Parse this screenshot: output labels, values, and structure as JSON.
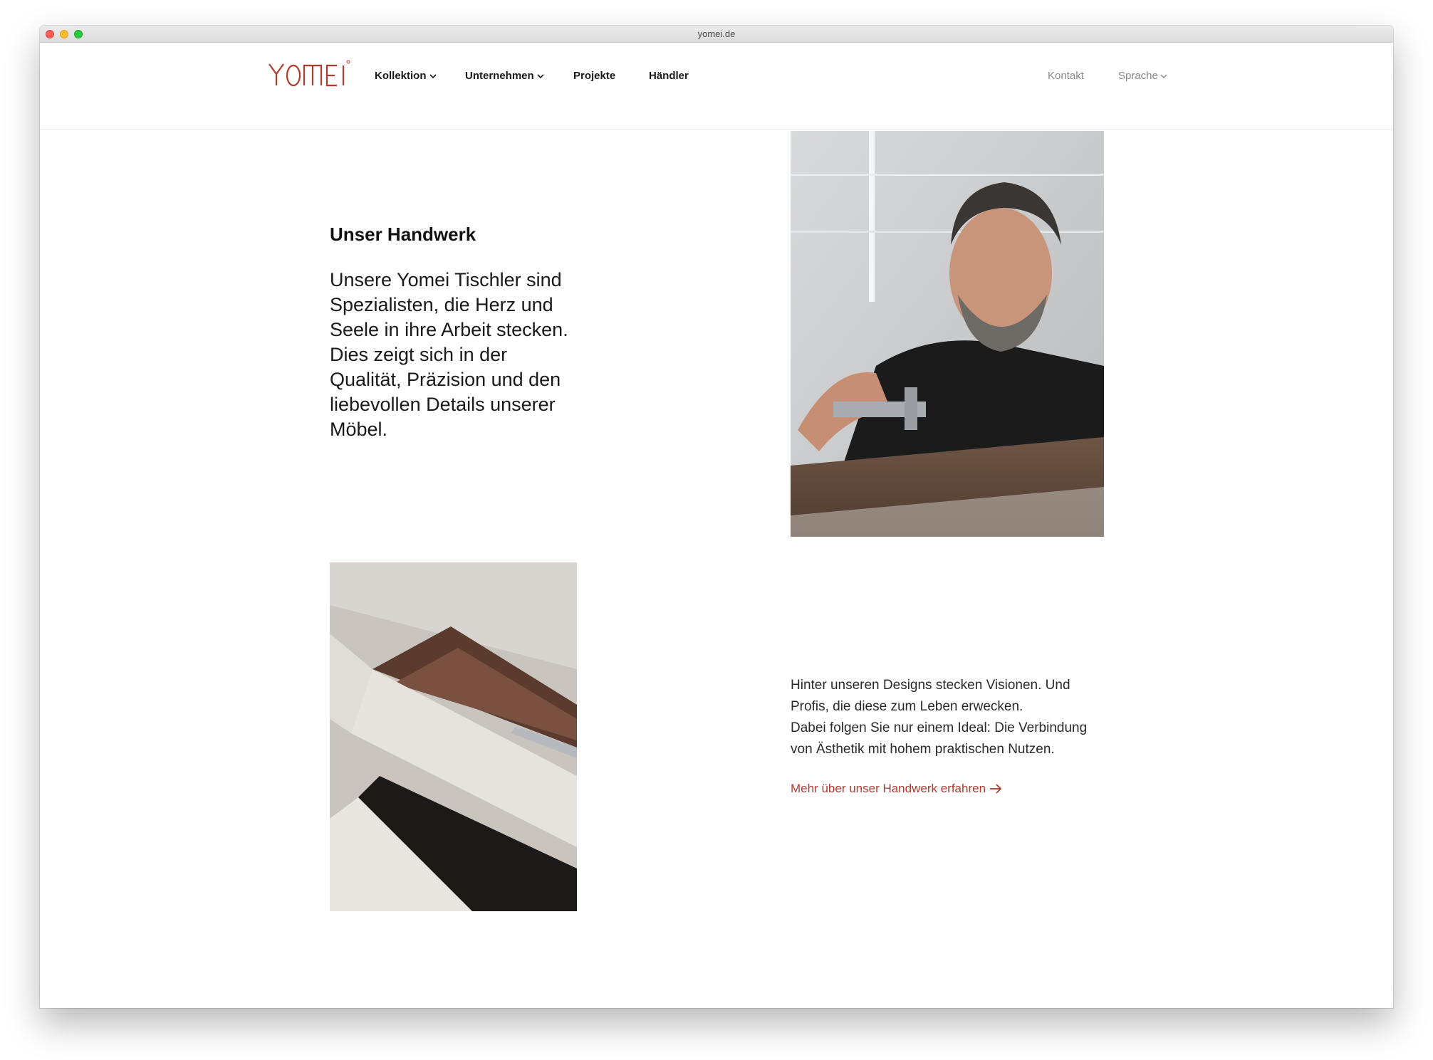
{
  "browser": {
    "url": "yomei.de"
  },
  "brand": {
    "logo_text": "YOMEI",
    "accent": "#b03a2e"
  },
  "nav": {
    "items": [
      {
        "label": "Kollektion",
        "dropdown": true
      },
      {
        "label": "Unternehmen",
        "dropdown": true
      },
      {
        "label": "Projekte",
        "dropdown": false
      },
      {
        "label": "Händler",
        "dropdown": false
      }
    ],
    "contact_label": "Kontakt",
    "language_label": "Sprache"
  },
  "section": {
    "title": "Unser Handwerk",
    "lead": "Unsere Yomei Tischler sind Spezialisten, die Herz und Seele in ihre Arbeit stecken. Dies zeigt sich in der Qualität, Präzision und den liebevollen Details unserer Möbel.",
    "body_line1": "Hinter unseren Designs stecken Visionen. Und Profis, die diese zum Leben erwecken.",
    "body_line2": "Dabei folgen Sie nur einem Ideal: Die Verbindung von Ästhetik mit hohem praktischen Nutzen.",
    "link_label": "Mehr über unser Handwerk erfahren"
  },
  "icons": {
    "chevron": "chevron-down-icon",
    "arrow": "arrow-right-icon"
  }
}
